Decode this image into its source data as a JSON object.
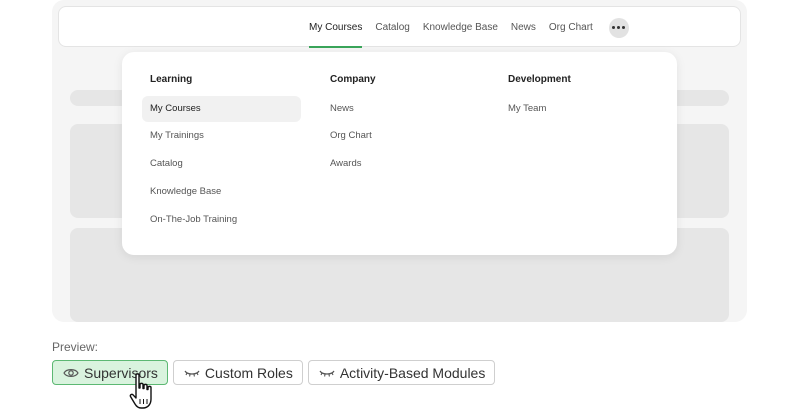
{
  "topnav": {
    "items": [
      {
        "label": "My Courses",
        "active": true
      },
      {
        "label": "Catalog"
      },
      {
        "label": "Knowledge Base"
      },
      {
        "label": "News"
      },
      {
        "label": "Org Chart"
      }
    ],
    "more_icon": "ellipsis-icon"
  },
  "menu": {
    "learning": {
      "title": "Learning",
      "items": [
        "My Courses",
        "My Trainings",
        "Catalog",
        "Knowledge Base",
        "On-The-Job Training"
      ]
    },
    "company": {
      "title": "Company",
      "items": [
        "News",
        "Org Chart",
        "Awards"
      ]
    },
    "development": {
      "title": "Development",
      "items": [
        "My Team"
      ]
    }
  },
  "preview": {
    "label": "Preview:",
    "chips": [
      {
        "label": "Supervisors",
        "icon": "eye-open-icon",
        "active": true
      },
      {
        "label": "Custom Roles",
        "icon": "eye-closed-icon"
      },
      {
        "label": "Activity-Based Modules",
        "icon": "eye-closed-icon"
      }
    ]
  },
  "colors": {
    "accent": "#3aa55a",
    "chip_active_bg": "#d9f3de",
    "chip_active_border": "#5cb873"
  }
}
